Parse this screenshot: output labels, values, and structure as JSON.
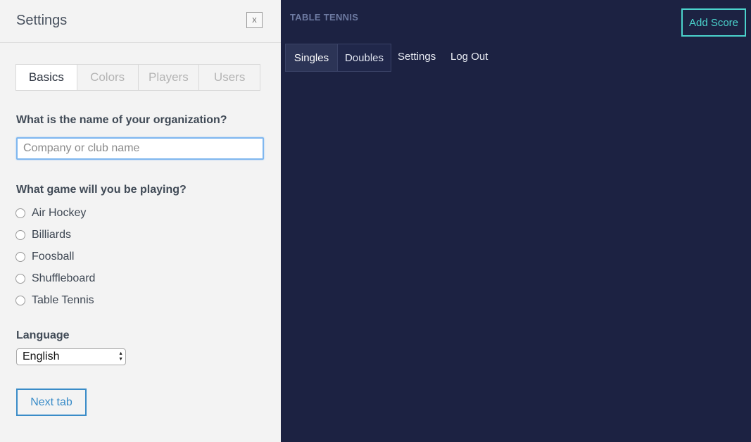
{
  "settings": {
    "title": "Settings",
    "close_label": "x",
    "tabs": [
      {
        "label": "Basics",
        "active": true
      },
      {
        "label": "Colors",
        "active": false
      },
      {
        "label": "Players",
        "active": false
      },
      {
        "label": "Users",
        "active": false
      }
    ],
    "org_question": "What is the name of your organization?",
    "org_input": {
      "value": "",
      "placeholder": "Company or club name"
    },
    "game_question": "What game will you be playing?",
    "games": [
      {
        "label": "Air Hockey"
      },
      {
        "label": "Billiards"
      },
      {
        "label": "Foosball"
      },
      {
        "label": "Shuffleboard"
      },
      {
        "label": "Table Tennis"
      }
    ],
    "language_label": "Language",
    "language_selected": "English",
    "next_label": "Next tab"
  },
  "main": {
    "app_title": "TABLE TENNIS",
    "add_score_label": "Add Score",
    "modes": [
      {
        "label": "Singles",
        "active": true
      },
      {
        "label": "Doubles",
        "active": false
      }
    ],
    "nav": {
      "settings": "Settings",
      "logout": "Log Out"
    }
  },
  "colors": {
    "main_background": "#1c2242",
    "panel_background": "#f3f3f3",
    "accent_teal": "#4bd3cc",
    "accent_blue": "#3a8cc8"
  },
  "icons": {
    "close": "close-icon",
    "select_arrows": "chevron-up-down-icon"
  }
}
